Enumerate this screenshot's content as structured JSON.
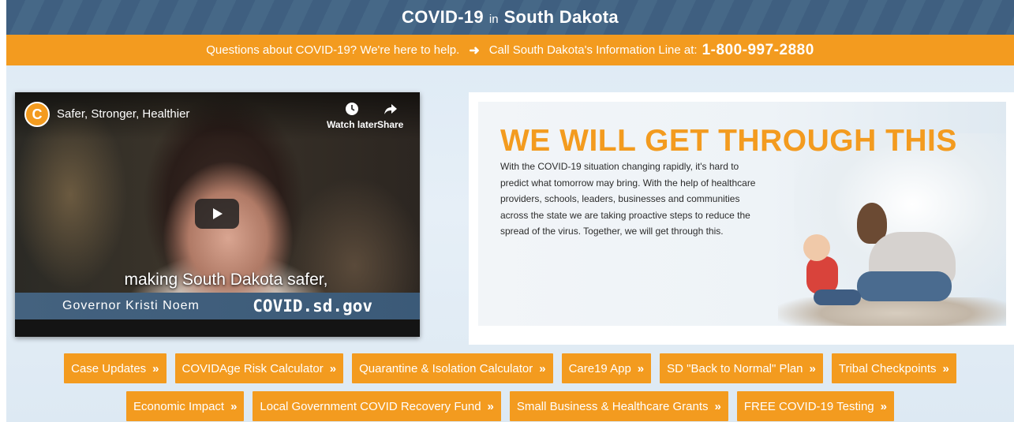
{
  "header": {
    "title_part1": "COVID-19",
    "title_connector": "in",
    "title_part2": "South Dakota"
  },
  "info_bar": {
    "question": "Questions about COVID-19? We're here to help.",
    "arrow_icon": "arrow-right-icon",
    "call_text": "Call South Dakota's Information Line at:",
    "phone": "1-800-997-2880"
  },
  "video": {
    "channel_logo_letter": "C",
    "title": "Safer, Stronger, Healthier",
    "watch_later_label": "Watch later",
    "share_label": "Share",
    "caption": "making South Dakota safer,",
    "lower_third_name": "Governor Kristi Noem",
    "lower_third_site": "COVID.sd.gov"
  },
  "promo": {
    "headline": "WE WILL GET THROUGH THIS",
    "body": "With the COVID-19 situation changing rapidly, it's hard to predict what tomorrow may bring. With the help of healthcare providers, schools, leaders, businesses and communities across the state we are taking proactive steps to reduce the spread of the virus. Together, we will get through this."
  },
  "buttons_row1": [
    {
      "label": "Case Updates"
    },
    {
      "label": "COVIDAge Risk Calculator"
    },
    {
      "label": "Quarantine & Isolation Calculator"
    },
    {
      "label": "Care19 App"
    },
    {
      "label": "SD \"Back to Normal\" Plan"
    },
    {
      "label": "Tribal Checkpoints"
    }
  ],
  "buttons_row2": [
    {
      "label": "Economic Impact"
    },
    {
      "label": "Local Government COVID Recovery Fund"
    },
    {
      "label": "Small Business & Healthcare Grants"
    },
    {
      "label": "FREE COVID-19 Testing"
    }
  ],
  "button_chevron": "»",
  "colors": {
    "accent_orange": "#f39b1f",
    "header_blue": "#3f5f80"
  }
}
